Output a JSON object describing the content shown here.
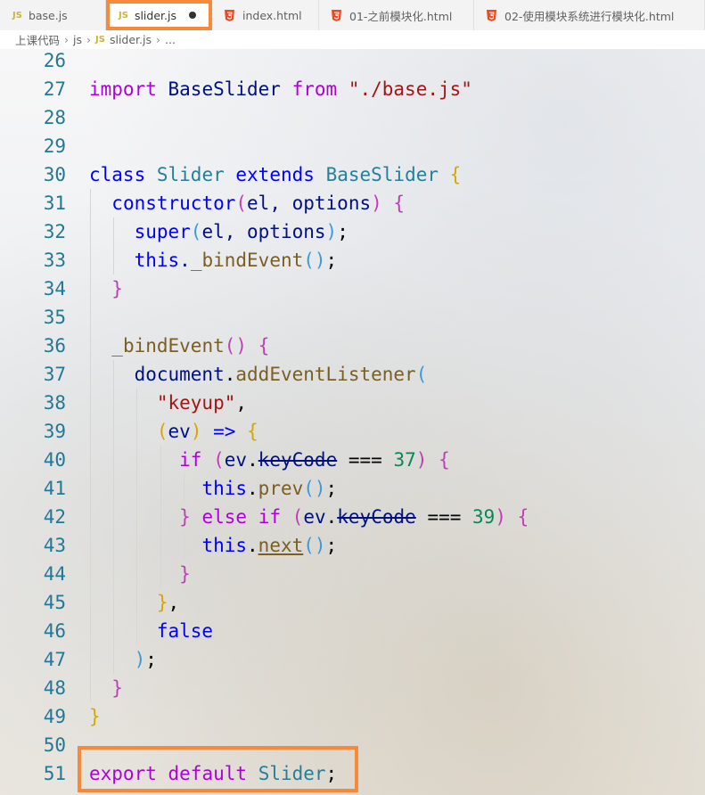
{
  "tabs": [
    {
      "label": "base.js",
      "type": "js"
    },
    {
      "label": "slider.js",
      "type": "js",
      "active": true,
      "dirty": true
    },
    {
      "label": "index.html",
      "type": "html"
    },
    {
      "label": "01-之前模块化.html",
      "type": "html"
    },
    {
      "label": "02-使用模块系统进行模块化.html",
      "type": "html"
    }
  ],
  "file_icons": {
    "js": "JS",
    "html": "html5-icon"
  },
  "breadcrumb": {
    "folder": "上课代码",
    "subfolder": "js",
    "file": "slider.js",
    "rest": "..."
  },
  "colors": {
    "highlight": "#f7893b",
    "line_number": "#237893"
  },
  "code": {
    "l27": {
      "n": "27",
      "import": "import",
      "name": "BaseSlider",
      "from": "from",
      "path": "\"./base.js\""
    },
    "l30": {
      "n": "30",
      "class": "class",
      "name": "Slider",
      "extends": "extends",
      "base": "BaseSlider",
      "brace": "{"
    },
    "l31": {
      "n": "31",
      "ctor": "constructor",
      "open": "(",
      "args": "el, options",
      "close": ")",
      "brace": "{"
    },
    "l32": {
      "n": "32",
      "super": "super",
      "open": "(",
      "args": "el, options",
      "close": ")",
      "semi": ";"
    },
    "l33": {
      "n": "33",
      "this": "this",
      "method": "_bindEvent",
      "parens": "()",
      "semi": ";"
    },
    "l34": {
      "n": "34",
      "brace": "}"
    },
    "l36": {
      "n": "36",
      "method": "_bindEvent",
      "parens": "()",
      "brace": "{"
    },
    "l37": {
      "n": "37",
      "obj": "document",
      "dot": ".",
      "method": "addEventListener",
      "open": "("
    },
    "l38": {
      "n": "38",
      "str": "\"keyup\"",
      "comma": ","
    },
    "l39": {
      "n": "39",
      "open": "(",
      "arg": "ev",
      "close": ")",
      "arrow": "=>",
      "brace": "{"
    },
    "l40": {
      "n": "40",
      "if": "if",
      "open": "(",
      "obj": "ev",
      "dot": ".",
      "prop": "keyCode",
      "op": "===",
      "num": "37",
      "close": ")",
      "brace": "{"
    },
    "l41": {
      "n": "41",
      "this": "this",
      "dot": ".",
      "method": "prev",
      "parens": "()",
      "semi": ";"
    },
    "l42": {
      "n": "42",
      "close_brace": "}",
      "else": "else",
      "if": "if",
      "open": "(",
      "obj": "ev",
      "dot": ".",
      "prop": "keyCode",
      "op": "===",
      "num": "39",
      "close": ")",
      "brace": "{"
    },
    "l43": {
      "n": "43",
      "this": "this",
      "dot": ".",
      "method": "next",
      "parens": "()",
      "semi": ";"
    },
    "l44": {
      "n": "44",
      "brace": "}"
    },
    "l45": {
      "n": "45",
      "brace": "}",
      "comma": ","
    },
    "l46": {
      "n": "46",
      "kw": "false"
    },
    "l47": {
      "n": "47",
      "close": ")",
      "semi": ";"
    },
    "l48": {
      "n": "48",
      "brace": "}"
    },
    "l49": {
      "n": "49",
      "brace": "}"
    },
    "l51": {
      "n": "51",
      "export": "export",
      "default": "default",
      "name": "Slider",
      "semi": ";"
    },
    "empty_lines": {
      "l26": "26",
      "l28": "28",
      "l29": "29",
      "l35": "35",
      "l50": "50"
    }
  }
}
